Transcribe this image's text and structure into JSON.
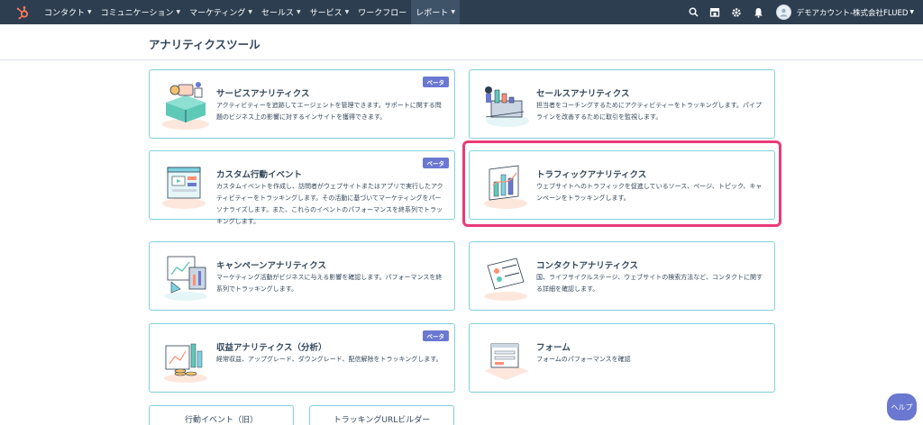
{
  "topnav": {
    "items": [
      {
        "label": "コンタクト"
      },
      {
        "label": "コミュニケーション"
      },
      {
        "label": "マーケティング"
      },
      {
        "label": "セールス"
      },
      {
        "label": "サービス"
      },
      {
        "label": "ワークフロー"
      },
      {
        "label": "レポート"
      }
    ],
    "account_name": "デモアカウント-株式会社FLUED",
    "colors": {
      "background": "#2d3e50",
      "active": "#3e5368",
      "logo": "#ff7a59"
    }
  },
  "page": {
    "title": "アナリティクスツール"
  },
  "cards": [
    {
      "title": "サービスアナリティクス",
      "desc": "アクティビティーを追跡してエージェントを管理できます。サポートに関する問題のビジネス上の影響に対するインサイトを獲得できます。",
      "badge": "ベータ",
      "icon": "service-analytics-illustration"
    },
    {
      "title": "セールスアナリティクス",
      "desc": "担当者をコーチングするためにアクティビティーをトラッキングします。パイプラインを改善するために取引を監視します。",
      "icon": "sales-analytics-illustration"
    },
    {
      "title": "カスタム行動イベント",
      "desc": "カスタムイベントを作成し、訪問者がウェブサイトまたはアプリで実行したアクティビティーをトラッキングします。その活動に基づいてマーケティングをパーソナライズします。また、これらのイベントのパフォーマンスを終系列でトラッキングします。",
      "badge": "ベータ",
      "icon": "custom-event-illustration"
    },
    {
      "title": "トラフィックアナリティクス",
      "desc": "ウェブサイトへのトラフィックを促進しているソース、ページ、トピック、キャンペーンをトラッキングします。",
      "icon": "traffic-analytics-illustration"
    },
    {
      "title": "キャンペーンアナリティクス",
      "desc": "マーケティング活動がビジネスに与える影響を確認します。パフォーマンスを終系列でトラッキングします。",
      "icon": "campaign-analytics-illustration"
    },
    {
      "title": "コンタクトアナリティクス",
      "desc": "国、ライフサイクルステージ、ウェブサイトの検索方法など、コンタクトに関する詳細を確認します。",
      "icon": "contact-analytics-illustration"
    },
    {
      "title": "収益アナリティクス（分析）",
      "desc": "経常収益、アップグレード、ダウングレード、配信解除をトラッキングします。",
      "badge": "ベータ",
      "icon": "revenue-analytics-illustration"
    },
    {
      "title": "フォーム",
      "desc": "フォームのパフォーマンスを確認",
      "icon": "forms-illustration"
    }
  ],
  "buttons": {
    "event_old": "行動イベント（旧）",
    "tracking_url": "トラッキングURLビルダー"
  },
  "help": {
    "label": "ヘルプ"
  },
  "accent": {
    "card_border": "#7fd1de",
    "beta": "#6a78d1",
    "highlight": "#ea3a78"
  }
}
